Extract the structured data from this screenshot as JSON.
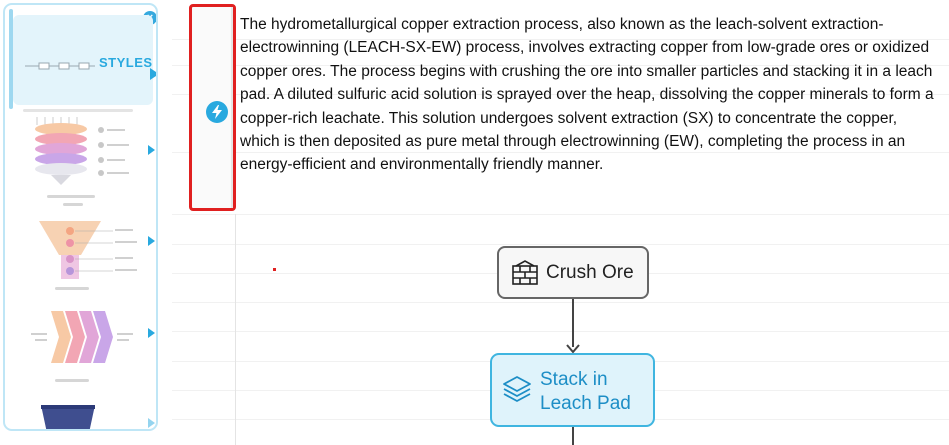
{
  "panel": {
    "styles_label": "STYLES",
    "close_icon": "close-circle-icon",
    "accent_color": "#29a9df"
  },
  "toolbar": {
    "quick_action_icon": "lightning-bolt-icon"
  },
  "document": {
    "paragraph": "The hydrometallurgical copper extraction process, also known as the leach-solvent extraction-electrowinning (LEACH-SX-EW) process, involves extracting copper from low-grade ores or oxidized copper ores. The process begins with crushing the ore into smaller particles and stacking it in a leach pad. A diluted sulfuric acid solution is sprayed over the heap, dissolving the copper minerals to form a copper-rich leachate. This solution undergoes solvent extraction (SX) to concentrate the copper, which is then deposited as pure metal through electrowinning (EW), completing the process in an energy-efficient and environmentally friendly manner."
  },
  "flowchart": {
    "nodes": [
      {
        "label": "Crush Ore",
        "icon": "brick-wall-icon"
      },
      {
        "label": "Stack in Leach Pad",
        "icon": "layers-stack-icon"
      }
    ]
  }
}
